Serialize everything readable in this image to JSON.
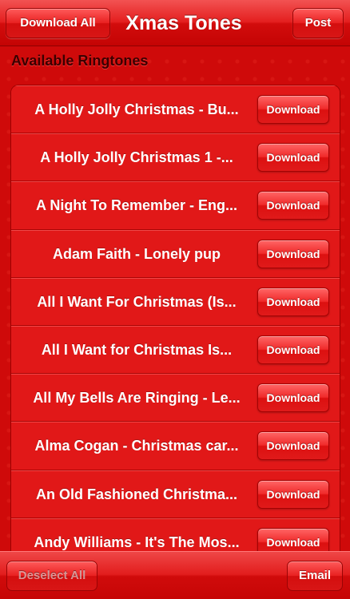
{
  "navbar": {
    "title": "Xmas Tones",
    "left_button": "Download All",
    "right_button": "Post"
  },
  "section": {
    "header": "Available Ringtones"
  },
  "ringtones": [
    {
      "title": "A Holly Jolly Christmas - Bu...",
      "button": "Download"
    },
    {
      "title": "A Holly Jolly Christmas 1 -...",
      "button": "Download"
    },
    {
      "title": "A Night To Remember - Eng...",
      "button": "Download"
    },
    {
      "title": "Adam Faith - Lonely pup",
      "button": "Download"
    },
    {
      "title": "All I Want For Christmas (Is...",
      "button": "Download"
    },
    {
      "title": "All I Want for Christmas Is...",
      "button": "Download"
    },
    {
      "title": "All My Bells Are Ringing - Le...",
      "button": "Download"
    },
    {
      "title": "Alma Cogan - Christmas car...",
      "button": "Download"
    },
    {
      "title": "An Old Fashioned Christma...",
      "button": "Download"
    },
    {
      "title": "Andy Williams - It's The Mos...",
      "button": "Download"
    }
  ],
  "toolbar": {
    "left_button": "Deselect All",
    "right_button": "Email"
  },
  "colors": {
    "background": "#cf0a0a",
    "row": "#e11818",
    "header_text": "#3b0000",
    "button_text": "#ffffff"
  }
}
